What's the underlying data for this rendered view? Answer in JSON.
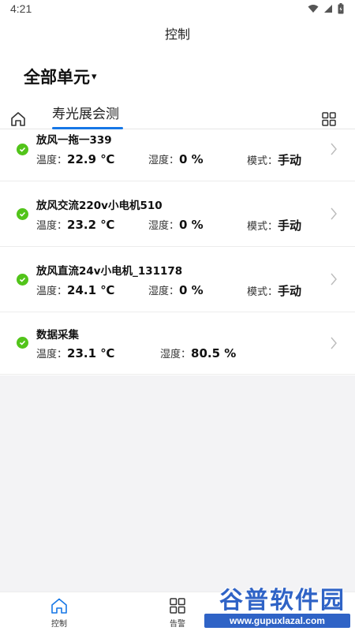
{
  "status_bar": {
    "time": "4:21"
  },
  "header": {
    "title": "控制"
  },
  "unit_selector": {
    "label": "全部单元",
    "caret": "▾"
  },
  "tabs": [
    {
      "label": "寿光展会测"
    }
  ],
  "devices": [
    {
      "name": "放风一拖一339",
      "temp_label": "温度：",
      "temp_value": "22.9 ℃",
      "hum_label": "湿度：",
      "hum_value": "0 %",
      "mode_label": "模式：",
      "mode_value": "手动"
    },
    {
      "name": "放风交流220v小电机510",
      "temp_label": "温度：",
      "temp_value": "23.2 ℃",
      "hum_label": "湿度：",
      "hum_value": "0 %",
      "mode_label": "模式：",
      "mode_value": "手动"
    },
    {
      "name": "放风直流24v小电机_131178",
      "temp_label": "温度：",
      "temp_value": "24.1 ℃",
      "hum_label": "湿度：",
      "hum_value": "0 %",
      "mode_label": "模式：",
      "mode_value": "手动"
    },
    {
      "name": "数据采集",
      "temp_label": "温度：",
      "temp_value": "23.1 ℃",
      "hum_label": "湿度：",
      "hum_value": "80.5 %"
    }
  ],
  "bottom_nav": [
    {
      "label": "控制",
      "icon": "home-icon",
      "active": true
    },
    {
      "label": "告警",
      "icon": "grid-icon",
      "active": false
    }
  ],
  "watermark": {
    "title": "谷普软件园",
    "url": "www.gupuxlazal.com"
  },
  "colors": {
    "accent": "#1677e6",
    "ok": "#52c41a",
    "background_gray": "#f3f3f5"
  }
}
